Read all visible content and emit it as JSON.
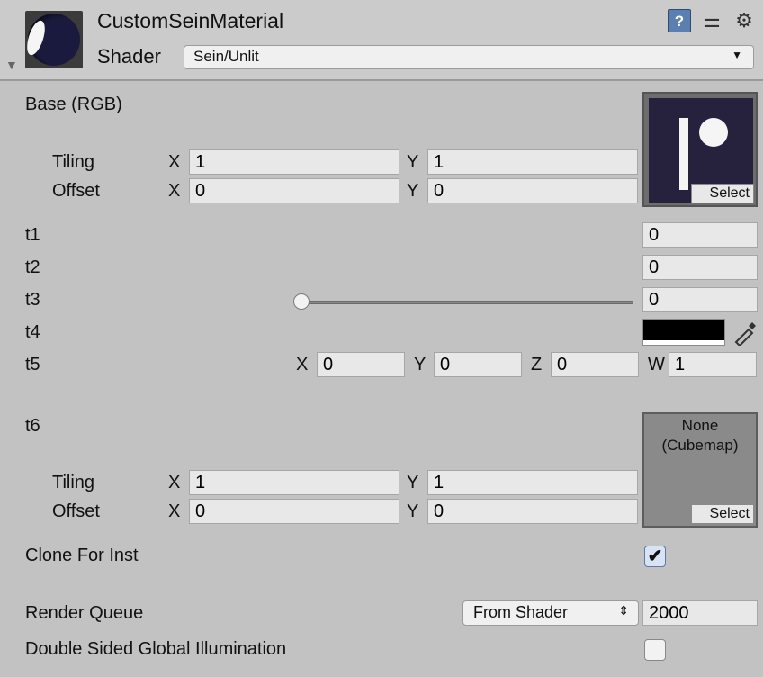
{
  "header": {
    "title": "CustomSeinMaterial",
    "shader_label": "Shader",
    "shader_value": "Sein/Unlit",
    "icons": [
      "help-icon",
      "preset-icon",
      "gear-icon"
    ]
  },
  "base": {
    "label": "Base (RGB)",
    "tiling_label": "Tiling",
    "offset_label": "Offset",
    "tiling": {
      "x": "1",
      "y": "1"
    },
    "offset": {
      "x": "0",
      "y": "0"
    },
    "select_label": "Select"
  },
  "axis": {
    "x": "X",
    "y": "Y",
    "z": "Z",
    "w": "W"
  },
  "t1": {
    "label": "t1",
    "value": "0"
  },
  "t2": {
    "label": "t2",
    "value": "0"
  },
  "t3": {
    "label": "t3",
    "value": "0",
    "slider_fraction": 0
  },
  "t4": {
    "label": "t4",
    "color": "#000000"
  },
  "t5": {
    "label": "t5",
    "x": "0",
    "y": "0",
    "z": "0",
    "w": "1"
  },
  "t6": {
    "label": "t6",
    "cubemap_none": "None",
    "cubemap_type": "(Cubemap)",
    "select_label": "Select",
    "tiling_label": "Tiling",
    "offset_label": "Offset",
    "tiling": {
      "x": "1",
      "y": "1"
    },
    "offset": {
      "x": "0",
      "y": "0"
    }
  },
  "clone_for_inst": {
    "label": "Clone For Inst",
    "checked": true
  },
  "render_queue": {
    "label": "Render Queue",
    "mode": "From Shader",
    "value": "2000"
  },
  "double_sided_gi": {
    "label": "Double Sided Global Illumination",
    "checked": false
  }
}
